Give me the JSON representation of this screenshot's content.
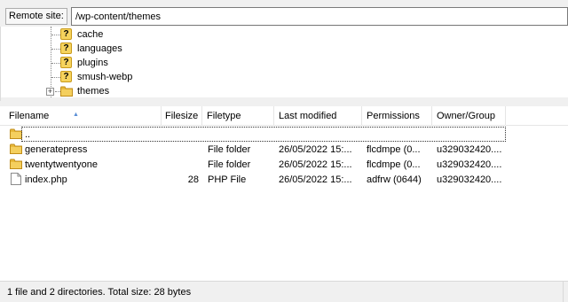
{
  "remote_site": {
    "label": "Remote site:",
    "path": "/wp-content/themes"
  },
  "tree": {
    "items": [
      {
        "label": "cache",
        "icon": "question-folder-icon"
      },
      {
        "label": "languages",
        "icon": "question-folder-icon"
      },
      {
        "label": "plugins",
        "icon": "question-folder-icon"
      },
      {
        "label": "smush-webp",
        "icon": "question-folder-icon"
      },
      {
        "label": "themes",
        "icon": "folder-icon",
        "expander": "+"
      }
    ]
  },
  "file_list": {
    "columns": [
      "Filename",
      "Filesize",
      "Filetype",
      "Last modified",
      "Permissions",
      "Owner/Group"
    ],
    "sort_column": "Filename",
    "rows": [
      {
        "name": "..",
        "size": "",
        "type": "",
        "modified": "",
        "perms": "",
        "owner": "",
        "icon": "folder-icon"
      },
      {
        "name": "generatepress",
        "size": "",
        "type": "File folder",
        "modified": "26/05/2022 15:...",
        "perms": "flcdmpe (0...",
        "owner": "u329032420....",
        "icon": "folder-icon"
      },
      {
        "name": "twentytwentyone",
        "size": "",
        "type": "File folder",
        "modified": "26/05/2022 15:...",
        "perms": "flcdmpe (0...",
        "owner": "u329032420....",
        "icon": "folder-icon"
      },
      {
        "name": "index.php",
        "size": "28",
        "type": "PHP File",
        "modified": "26/05/2022 15:...",
        "perms": "adfrw (0644)",
        "owner": "u329032420....",
        "icon": "file-icon"
      }
    ]
  },
  "status": {
    "text": "1 file and 2 directories. Total size: 28 bytes"
  },
  "colors": {
    "folder": "#e8b93a",
    "question_icon": "#f6d35d",
    "chrome": "#f0f0f0",
    "sort_arrow": "#5b8fd6"
  }
}
